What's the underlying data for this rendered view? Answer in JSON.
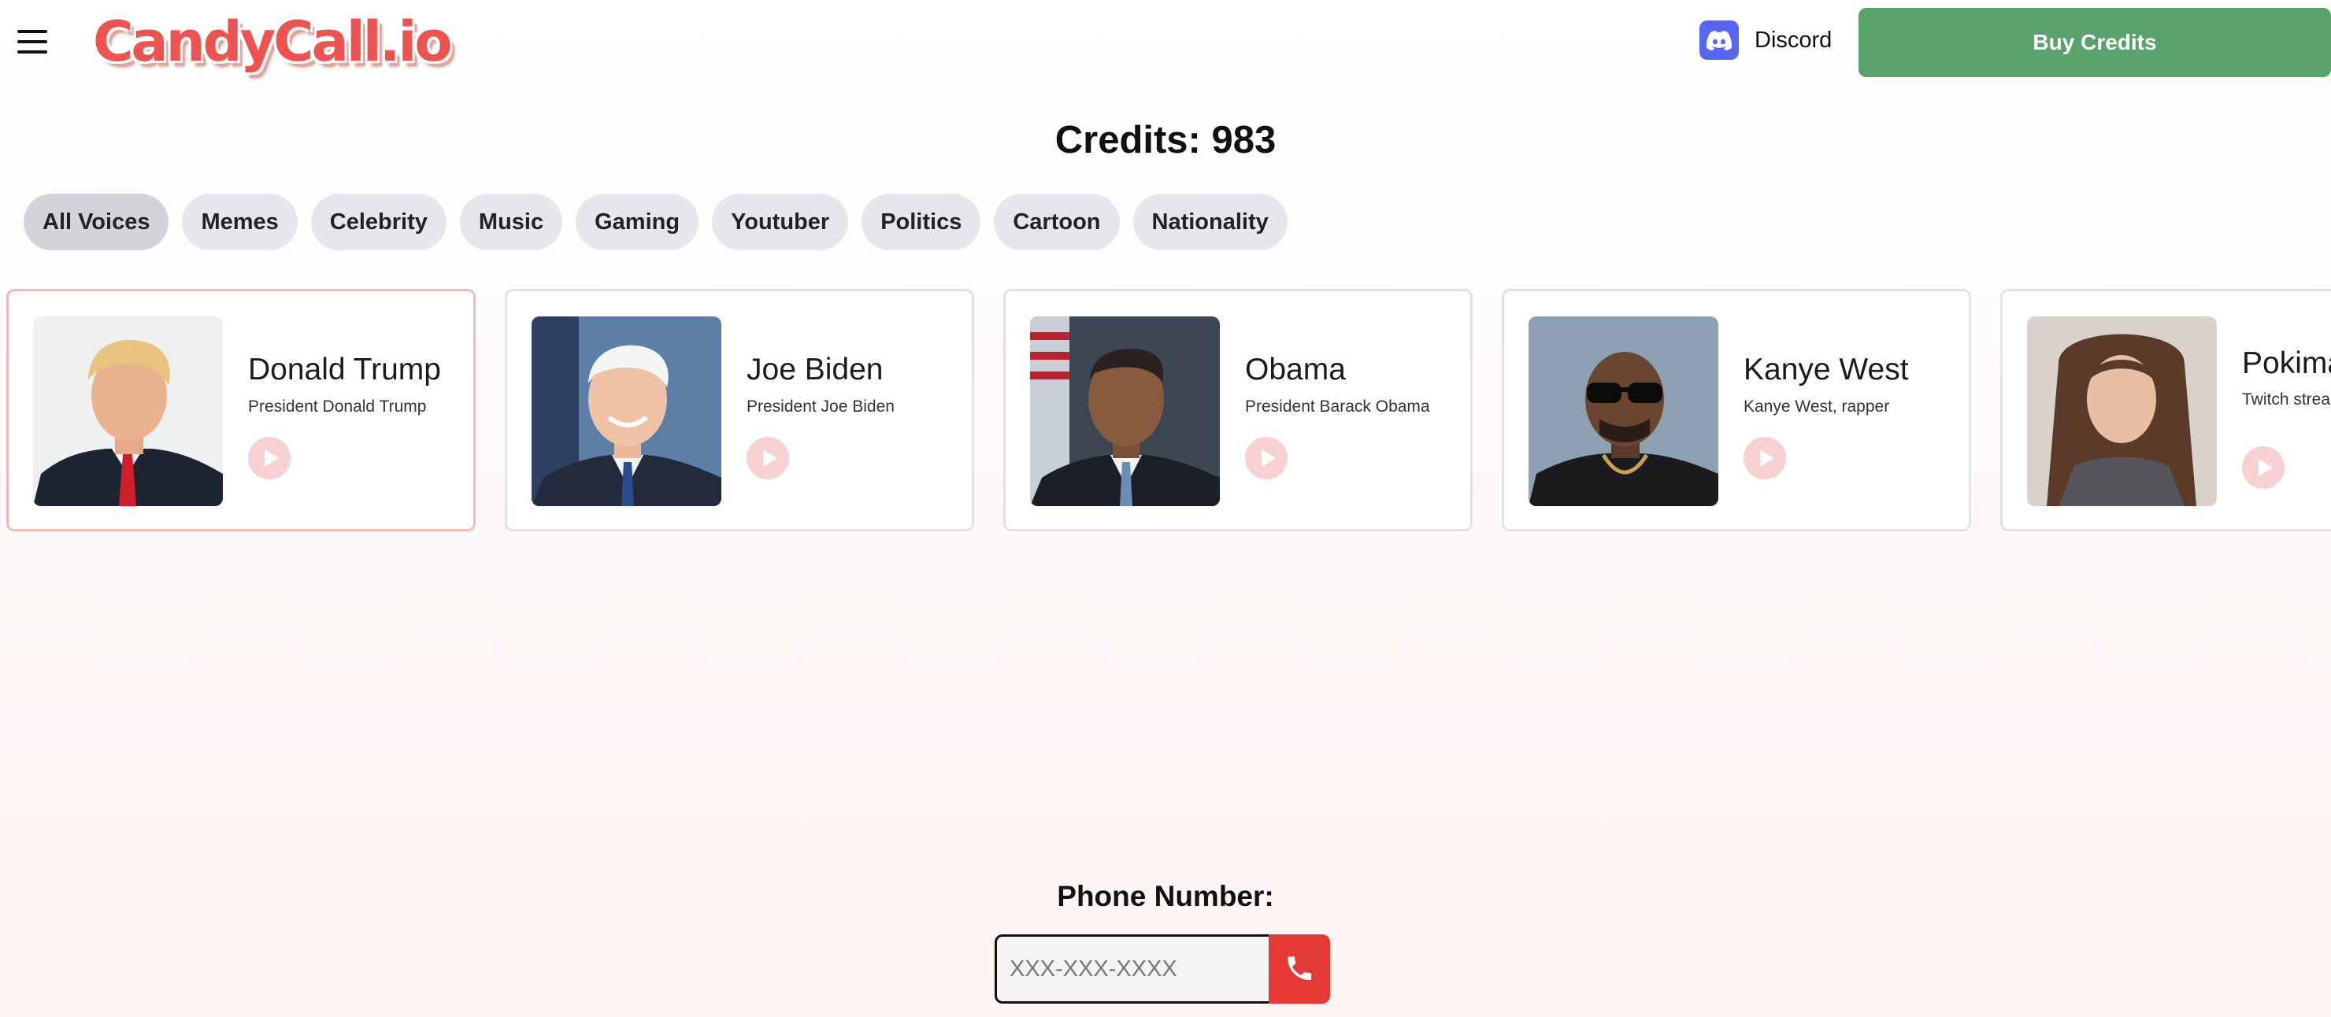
{
  "header": {
    "logo_text": "CandyCall.io",
    "discord_label": "Discord",
    "buy_label": "Buy Credits"
  },
  "credits_text": "Credits: 983",
  "tabs": [
    "All Voices",
    "Memes",
    "Celebrity",
    "Music",
    "Gaming",
    "Youtuber",
    "Politics",
    "Cartoon",
    "Nationality"
  ],
  "voices": [
    {
      "name": "Donald Trump",
      "description": "President Donald Trump"
    },
    {
      "name": "Joe Biden",
      "description": "President Joe Biden"
    },
    {
      "name": "Obama",
      "description": "President Barack Obama"
    },
    {
      "name": "Kanye West",
      "description": "Kanye West, rapper"
    },
    {
      "name": "Pokimane",
      "description": "Twitch streamer Pokimane"
    }
  ],
  "phone": {
    "label": "Phone Number:",
    "placeholder": "XXX-XXX-XXXX"
  },
  "colors": {
    "brand": "#ef5350",
    "buy_button": "#5aa26b",
    "call_button": "#e53935",
    "discord": "#5865f2"
  },
  "icons": [
    "menu-icon",
    "discord-icon",
    "play-icon",
    "phone-icon"
  ]
}
